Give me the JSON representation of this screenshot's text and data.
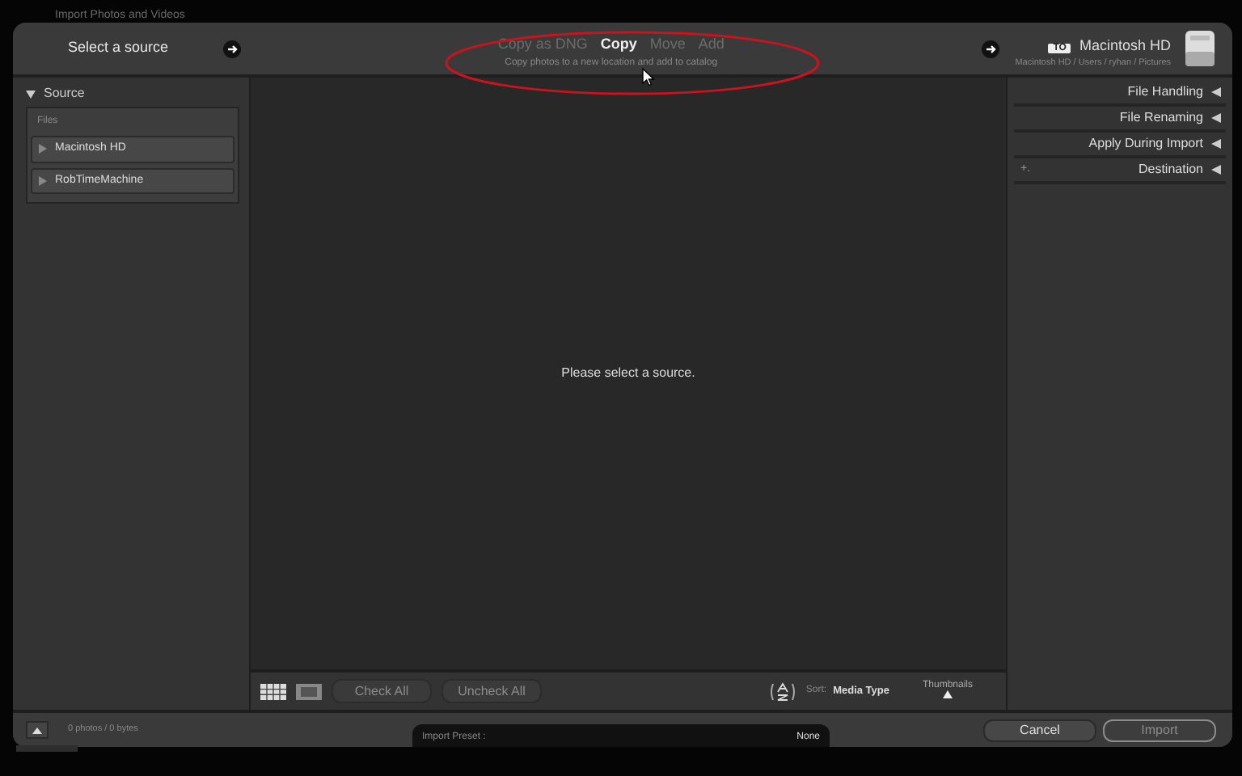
{
  "window": {
    "title": "Import Photos and Videos"
  },
  "header": {
    "source_selector": "Select a source",
    "modes": [
      {
        "label": "Copy as DNG",
        "selected": false
      },
      {
        "label": "Copy",
        "selected": true
      },
      {
        "label": "Move",
        "selected": false
      },
      {
        "label": "Add",
        "selected": false
      }
    ],
    "mode_description": "Copy photos to a new location and add to catalog",
    "destination": {
      "tag": "TO",
      "name": "Macintosh HD",
      "path": "Macintosh HD / Users / ryhan / Pictures"
    }
  },
  "source_panel": {
    "title": "Source",
    "expanded": true,
    "group": "Files",
    "items": [
      {
        "label": "Macintosh HD"
      },
      {
        "label": "RobTimeMachine"
      }
    ]
  },
  "center": {
    "message": "Please select a source."
  },
  "toolbar": {
    "views": [
      {
        "kind": "grid",
        "selected": true
      },
      {
        "kind": "loupe",
        "selected": false
      }
    ],
    "buttons": [
      {
        "label": "Check All",
        "disabled": true
      },
      {
        "label": "Uncheck All",
        "disabled": true
      }
    ],
    "sort_label": "Sort:",
    "sort_value": "Media Type",
    "thumbnails_label": "Thumbnails"
  },
  "right_panel": {
    "sections": [
      {
        "title": "File Handling",
        "expanded": false
      },
      {
        "title": "File Renaming",
        "expanded": false
      },
      {
        "title": "Apply During Import",
        "expanded": false
      },
      {
        "title": "Destination",
        "expanded": false,
        "plus": "+."
      }
    ]
  },
  "footer": {
    "count": "0 photos / 0 bytes",
    "preset_label": "Import Preset :",
    "preset_value": "None",
    "buttons": [
      {
        "label": "Cancel",
        "disabled": false
      },
      {
        "label": "Import",
        "disabled": true
      }
    ]
  }
}
